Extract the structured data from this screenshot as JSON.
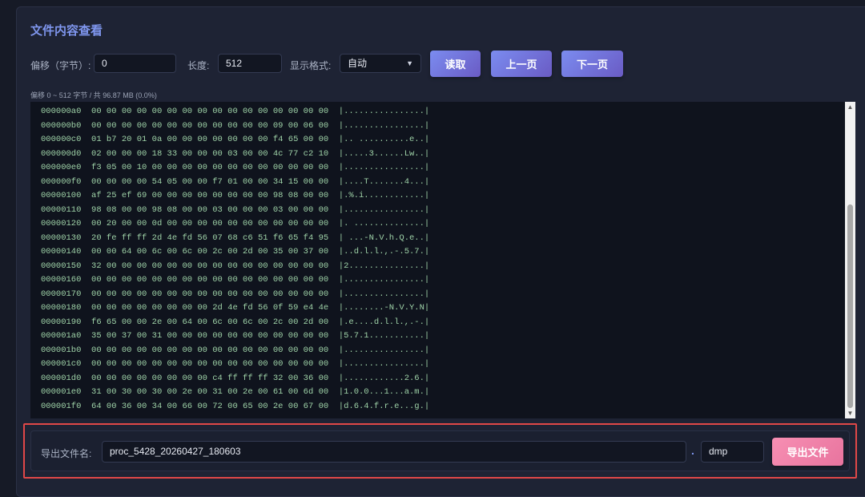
{
  "title": "文件内容查看",
  "controls": {
    "offset_label": "偏移（字节）:",
    "offset_value": "0",
    "length_label": "长度:",
    "length_value": "512",
    "format_label": "显示格式:",
    "format_value": "自动",
    "read_button": "读取",
    "prev_button": "上一页",
    "next_button": "下一页"
  },
  "status": "偏移 0 ~ 512 字节 / 共 96.87 MB (0.0%)",
  "hex_lines": [
    {
      "offset": "000000a0",
      "hex": "00 00 00 00 00 00 00 00 00 00 00 00 00 00 00 00",
      "ascii": "|................|"
    },
    {
      "offset": "000000b0",
      "hex": "00 00 00 00 00 00 00 00 00 00 00 00 09 00 06 00",
      "ascii": "|................|"
    },
    {
      "offset": "000000c0",
      "hex": "01 b7 20 01 0a 00 00 00 00 00 00 00 f4 65 00 00",
      "ascii": "|.. ..........e..|"
    },
    {
      "offset": "000000d0",
      "hex": "02 00 00 00 18 33 00 00 00 03 00 00 4c 77 c2 10",
      "ascii": "|.....3......Lw..|"
    },
    {
      "offset": "000000e0",
      "hex": "f3 05 00 10 00 00 00 00 00 00 00 00 00 00 00 00",
      "ascii": "|................|"
    },
    {
      "offset": "000000f0",
      "hex": "00 00 00 00 54 05 00 00 f7 01 00 00 34 15 00 00",
      "ascii": "|....T.......4...|"
    },
    {
      "offset": "00000100",
      "hex": "af 25 ef 69 00 00 00 00 00 00 00 00 98 08 00 00",
      "ascii": "|.%.i............|"
    },
    {
      "offset": "00000110",
      "hex": "98 08 00 00 98 08 00 00 03 00 00 00 03 00 00 00",
      "ascii": "|................|"
    },
    {
      "offset": "00000120",
      "hex": "00 20 00 00 0d 00 00 00 00 00 00 00 00 00 00 00",
      "ascii": "|. ..............|"
    },
    {
      "offset": "00000130",
      "hex": "20 fe ff ff 2d 4e fd 56 07 68 c6 51 f6 65 f4 95",
      "ascii": "| ...-N.V.h.Q.e..|"
    },
    {
      "offset": "00000140",
      "hex": "00 00 64 00 6c 00 6c 00 2c 00 2d 00 35 00 37 00",
      "ascii": "|..d.l.l.,.-.5.7.|"
    },
    {
      "offset": "00000150",
      "hex": "32 00 00 00 00 00 00 00 00 00 00 00 00 00 00 00",
      "ascii": "|2...............|"
    },
    {
      "offset": "00000160",
      "hex": "00 00 00 00 00 00 00 00 00 00 00 00 00 00 00 00",
      "ascii": "|................|"
    },
    {
      "offset": "00000170",
      "hex": "00 00 00 00 00 00 00 00 00 00 00 00 00 00 00 00",
      "ascii": "|................|"
    },
    {
      "offset": "00000180",
      "hex": "00 00 00 00 00 00 00 00 2d 4e fd 56 0f 59 e4 4e",
      "ascii": "|........-N.V.Y.N|"
    },
    {
      "offset": "00000190",
      "hex": "f6 65 00 00 2e 00 64 00 6c 00 6c 00 2c 00 2d 00",
      "ascii": "|.e....d.l.l.,.-.|"
    },
    {
      "offset": "000001a0",
      "hex": "35 00 37 00 31 00 00 00 00 00 00 00 00 00 00 00",
      "ascii": "|5.7.1...........|"
    },
    {
      "offset": "000001b0",
      "hex": "00 00 00 00 00 00 00 00 00 00 00 00 00 00 00 00",
      "ascii": "|................|"
    },
    {
      "offset": "000001c0",
      "hex": "00 00 00 00 00 00 00 00 00 00 00 00 00 00 00 00",
      "ascii": "|................|"
    },
    {
      "offset": "000001d0",
      "hex": "00 00 00 00 00 00 00 00 c4 ff ff ff 32 00 36 00",
      "ascii": "|............2.6.|"
    },
    {
      "offset": "000001e0",
      "hex": "31 00 30 00 30 00 2e 00 31 00 2e 00 61 00 6d 00",
      "ascii": "|1.0.0...1...a.m.|"
    },
    {
      "offset": "000001f0",
      "hex": "64 00 36 00 34 00 66 00 72 00 65 00 2e 00 67 00",
      "ascii": "|d.6.4.f.r.e...g.|"
    }
  ],
  "export": {
    "label": "导出文件名:",
    "filename": "proc_5428_20260427_180603",
    "separator": ".",
    "extension": "dmp",
    "button": "导出文件"
  }
}
